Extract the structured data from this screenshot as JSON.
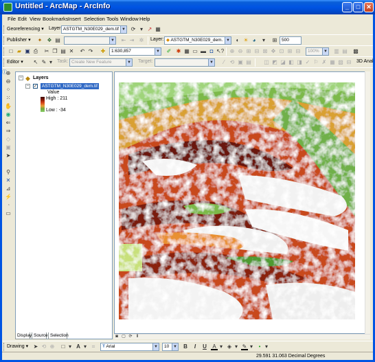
{
  "window": {
    "title": "Untitled - ArcMap - ArcInfo",
    "min_glyph": "_",
    "max_glyph": "□",
    "close_glyph": "✕"
  },
  "menu": {
    "items": [
      "File",
      "Edit",
      "View",
      "Bookmarks",
      "Insert",
      "Selection",
      "Tools",
      "Window",
      "Help"
    ]
  },
  "georef_toolbar": {
    "menu_label": "Georeferencing ▾",
    "layer_label": "Layer:",
    "layer_value": "ASTGTM_N30E029_dem.tif"
  },
  "publisher_toolbar": {
    "menu_label": "Publisher ▾"
  },
  "spatial_toolbar": {
    "layer_label": "Layer:",
    "layer_value": "ASTGTM_N30E029_dem.",
    "resolution_value": "500"
  },
  "standard_toolbar": {
    "scale_value": "1:630,857",
    "zoom_value": "100%"
  },
  "editor_toolbar": {
    "menu_label": "Editor ▾",
    "task_label": "Task:",
    "task_value": "Create New Feature",
    "target_label": "Target:",
    "target_value": "",
    "arc_label": "3D Anal"
  },
  "toc": {
    "root_label": "Layers",
    "layer_name": "ASTGTM_N30E029_dem.tif",
    "value_label": "Value",
    "high_label": "High : 211",
    "low_label": "Low : -34",
    "tabs": [
      "Display",
      "Source",
      "Selection"
    ]
  },
  "drawing_toolbar": {
    "menu_label": "Drawing ▾",
    "font_value": "Arial",
    "size_value": "10",
    "bold": "B",
    "italic": "I",
    "underline": "U"
  },
  "status": {
    "coords": "29.591  31.063 Decimal Degrees"
  },
  "colors": {
    "title_blue": "#0054e3",
    "chrome": "#ece9d8",
    "dem_high": "#3b0a04",
    "dem_mid": "#d9451a",
    "dem_low": "#6fa838"
  }
}
